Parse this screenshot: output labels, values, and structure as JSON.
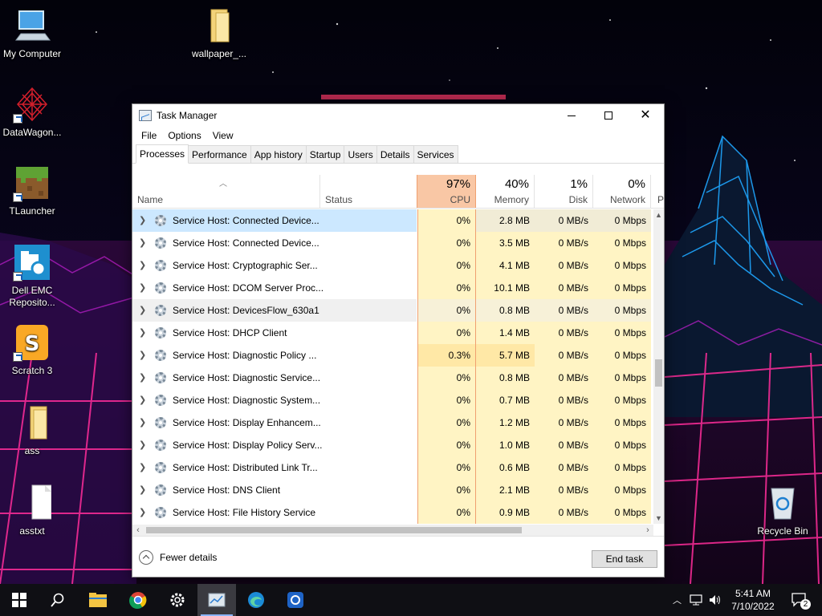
{
  "desktop": {
    "icons": [
      {
        "label": "My Computer",
        "icon": "computer-icon"
      },
      {
        "label": "wallpaper_...",
        "icon": "folder-icon"
      },
      {
        "label": "DataWagon...",
        "icon": "datawagon-icon"
      },
      {
        "label": "TLauncher",
        "icon": "grass-block-icon"
      },
      {
        "label": "Dell EMC Reposito...",
        "icon": "dell-emc-icon"
      },
      {
        "label": "Scratch 3",
        "icon": "scratch-icon"
      },
      {
        "label": "ass",
        "icon": "folder-icon"
      },
      {
        "label": "asstxt",
        "icon": "text-file-icon"
      },
      {
        "label": "Recycle Bin",
        "icon": "recycle-bin-icon"
      }
    ]
  },
  "taskmanager": {
    "title": "Task Manager",
    "menu": [
      "File",
      "Options",
      "View"
    ],
    "tabs": [
      "Processes",
      "Performance",
      "App history",
      "Startup",
      "Users",
      "Details",
      "Services"
    ],
    "active_tab": "Processes",
    "columns": {
      "name": "Name",
      "status": "Status",
      "cpu": {
        "pct": "97%",
        "label": "CPU"
      },
      "memory": {
        "pct": "40%",
        "label": "Memory"
      },
      "disk": {
        "pct": "1%",
        "label": "Disk"
      },
      "network": {
        "pct": "0%",
        "label": "Network"
      },
      "power": "P"
    },
    "rows": [
      {
        "name": "Service Host: Connected Device...",
        "status": "",
        "cpu": "0%",
        "memory": "2.8 MB",
        "disk": "0 MB/s",
        "network": "0 Mbps",
        "state": "selected"
      },
      {
        "name": "Service Host: Connected Device...",
        "status": "",
        "cpu": "0%",
        "memory": "3.5 MB",
        "disk": "0 MB/s",
        "network": "0 Mbps",
        "state": ""
      },
      {
        "name": "Service Host: Cryptographic Ser...",
        "status": "",
        "cpu": "0%",
        "memory": "4.1 MB",
        "disk": "0 MB/s",
        "network": "0 Mbps",
        "state": ""
      },
      {
        "name": "Service Host: DCOM Server Proc...",
        "status": "",
        "cpu": "0%",
        "memory": "10.1 MB",
        "disk": "0 MB/s",
        "network": "0 Mbps",
        "state": ""
      },
      {
        "name": "Service Host: DevicesFlow_630a1",
        "status": "",
        "cpu": "0%",
        "memory": "0.8 MB",
        "disk": "0 MB/s",
        "network": "0 Mbps",
        "state": "hover"
      },
      {
        "name": "Service Host: DHCP Client",
        "status": "",
        "cpu": "0%",
        "memory": "1.4 MB",
        "disk": "0 MB/s",
        "network": "0 Mbps",
        "state": ""
      },
      {
        "name": "Service Host: Diagnostic Policy ...",
        "status": "",
        "cpu": "0.3%",
        "memory": "5.7 MB",
        "disk": "0 MB/s",
        "network": "0 Mbps",
        "state": "warm"
      },
      {
        "name": "Service Host: Diagnostic Service...",
        "status": "",
        "cpu": "0%",
        "memory": "0.8 MB",
        "disk": "0 MB/s",
        "network": "0 Mbps",
        "state": ""
      },
      {
        "name": "Service Host: Diagnostic System...",
        "status": "",
        "cpu": "0%",
        "memory": "0.7 MB",
        "disk": "0 MB/s",
        "network": "0 Mbps",
        "state": ""
      },
      {
        "name": "Service Host: Display Enhancem...",
        "status": "",
        "cpu": "0%",
        "memory": "1.2 MB",
        "disk": "0 MB/s",
        "network": "0 Mbps",
        "state": ""
      },
      {
        "name": "Service Host: Display Policy Serv...",
        "status": "",
        "cpu": "0%",
        "memory": "1.0 MB",
        "disk": "0 MB/s",
        "network": "0 Mbps",
        "state": ""
      },
      {
        "name": "Service Host: Distributed Link Tr...",
        "status": "",
        "cpu": "0%",
        "memory": "0.6 MB",
        "disk": "0 MB/s",
        "network": "0 Mbps",
        "state": ""
      },
      {
        "name": "Service Host: DNS Client",
        "status": "",
        "cpu": "0%",
        "memory": "2.1 MB",
        "disk": "0 MB/s",
        "network": "0 Mbps",
        "state": ""
      },
      {
        "name": "Service Host: File History Service",
        "status": "",
        "cpu": "0%",
        "memory": "0.9 MB",
        "disk": "0 MB/s",
        "network": "0 Mbps",
        "state": ""
      }
    ],
    "footer": {
      "fewer_details": "Fewer details",
      "end_task": "End task"
    }
  },
  "taskbar": {
    "pinned": [
      "windows-start-icon",
      "search-icon",
      "file-explorer-icon",
      "chrome-icon",
      "settings-icon",
      "task-manager-icon",
      "edge-icon",
      "remote-desktop-icon"
    ],
    "active": "task-manager-icon",
    "clock": {
      "time": "5:41 AM",
      "date": "7/10/2022"
    },
    "notification_count": "2"
  },
  "colors": {
    "cpu_hot_header": "#f9c7a5",
    "usage_cell": "#fff4c4",
    "selected_row": "#cce8ff",
    "taskbar": "#0f0f14"
  }
}
